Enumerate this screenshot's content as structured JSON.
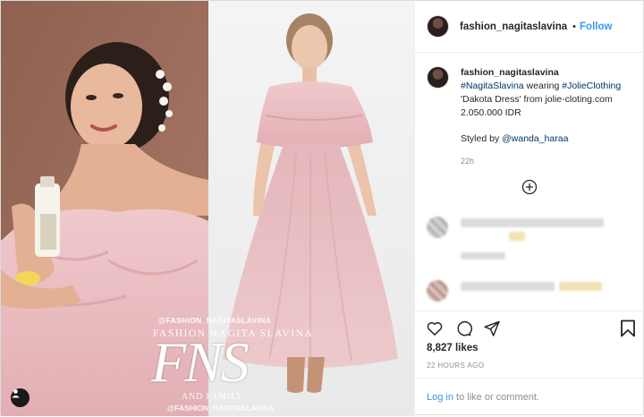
{
  "post": {
    "username": "fashion_nagitaslavina",
    "dot": "•",
    "follow_label": "Follow",
    "caption": {
      "username": "fashion_nagitaslavina",
      "hashtag1": "#NagitaSlavina",
      "text1": " wearing ",
      "hashtag2": "#JolieClothing",
      "text2": " 'Dakota Dress' from jolie-cloting.com 2.050.000 IDR",
      "styled_prefix": "Styled by ",
      "mention": "@wanda_haraa",
      "time": "22h"
    },
    "likes": "8,827 likes",
    "time_ago": "22 HOURS AGO",
    "login_link": "Log in",
    "login_rest": " to like or comment."
  },
  "image": {
    "watermark_handle": "@FASHION_NAGITASLAVINA",
    "watermark_name": "FASHION NAGITA SLAVINA",
    "watermark_logo": "FNS",
    "watermark_family": "AND FAMILY",
    "watermark_handle2": "@FASHION_NAGITASLAVINA"
  },
  "icons": {
    "heart": "heart-icon",
    "comment": "comment-icon",
    "share": "share-icon",
    "bookmark": "bookmark-icon",
    "load_more": "plus-circle-icon",
    "user_tag": "user-tag-icon"
  },
  "colors": {
    "link_blue": "#3897f0",
    "hashtag_navy": "#003569",
    "muted": "#8e8e8e",
    "dress_pink": "#e8b9bd",
    "backdrop_brown": "#9a6a57"
  }
}
